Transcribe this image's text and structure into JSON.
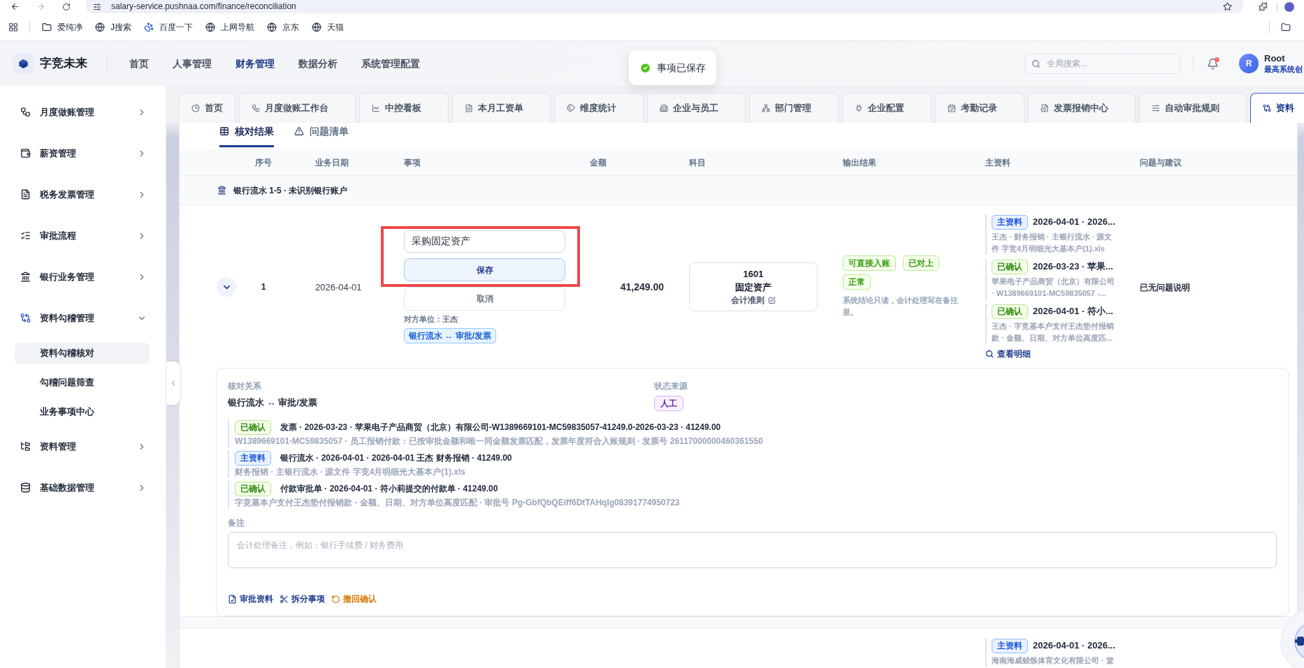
{
  "browser": {
    "url": "salary-service.pushnaa.com/finance/reconciliation",
    "bookmarks": [
      "爱纯净",
      "J搜索",
      "百度一下",
      "上网导航",
      "京东",
      "天猫"
    ]
  },
  "header": {
    "brand": "字竞未来",
    "nav": [
      {
        "label": "首页",
        "selected": false
      },
      {
        "label": "人事管理",
        "selected": false
      },
      {
        "label": "财务管理",
        "selected": true
      },
      {
        "label": "数据分析",
        "selected": false
      },
      {
        "label": "系统管理配置",
        "selected": false
      }
    ],
    "search": {
      "placeholder": "全局搜索..."
    },
    "notifications": {
      "unread": true
    },
    "user": {
      "initial": "R",
      "name": "Root",
      "role": "最高系统创"
    }
  },
  "toast": {
    "kind": "success",
    "text": "事项已保存"
  },
  "sidebar": {
    "items": [
      {
        "label": "月度做账管理",
        "expanded": false
      },
      {
        "label": "薪资管理",
        "expanded": false
      },
      {
        "label": "税务发票管理",
        "expanded": false
      },
      {
        "label": "审批流程",
        "expanded": false
      },
      {
        "label": "银行业务管理",
        "expanded": false
      },
      {
        "label": "资料勾稽管理",
        "expanded": true,
        "children": [
          {
            "label": "资料勾稽核对",
            "selected": true
          },
          {
            "label": "勾稽问题筛查",
            "selected": false
          },
          {
            "label": "业务事项中心",
            "selected": false
          }
        ]
      },
      {
        "label": "资料管理",
        "expanded": false
      },
      {
        "label": "基础数据管理",
        "expanded": false
      }
    ]
  },
  "tabs": [
    {
      "label": "首页",
      "selected": false
    },
    {
      "label": "月度做账工作台",
      "selected": false
    },
    {
      "label": "中控看板",
      "selected": false
    },
    {
      "label": "本月工资单",
      "selected": false
    },
    {
      "label": "维度统计",
      "selected": false
    },
    {
      "label": "企业与员工",
      "selected": false
    },
    {
      "label": "部门管理",
      "selected": false
    },
    {
      "label": "企业配置",
      "selected": false
    },
    {
      "label": "考勤记录",
      "selected": false
    },
    {
      "label": "发票报销中心",
      "selected": false
    },
    {
      "label": "自动审批规则",
      "selected": false
    },
    {
      "label": "资料",
      "selected": true
    }
  ],
  "view_tabs": [
    {
      "label": "核对结果",
      "selected": true
    },
    {
      "label": "问题清单",
      "selected": false
    }
  ],
  "table": {
    "columns": [
      "序号",
      "业务日期",
      "事项",
      "金额",
      "科目",
      "输出结果",
      "主资料",
      "问题与建议"
    ],
    "groups": [
      {
        "title": "银行流水 1-5 · 未识别银行账户",
        "rows": [
          {
            "expanded": true,
            "seq": "1",
            "date": "2026-04-01",
            "editor": {
              "value": "采购固定资产",
              "save": "保存",
              "cancel": "取消"
            },
            "counterparty": "对方单位：王杰",
            "relation_tag": "银行流水 ↔ 审批/发票",
            "amount": "41,249.00",
            "subject": {
              "code": "1601",
              "name": "固定资产",
              "link": "会计准则"
            },
            "output": {
              "tags": [
                "可直接入账",
                "已对上",
                "正常"
              ],
              "note": "系统结论只读，会计处理写在备注里。"
            },
            "main_data": [
              {
                "kind": "primary",
                "badge": "主资料",
                "title": "2026-04-01 · 2026...",
                "detail": "王杰 · 财务报销 · 主银行流水 · 源文件 字竞4月明细光大基本户(1).xls"
              },
              {
                "kind": "confirmed",
                "badge": "已确认",
                "title": "2026-03-23 · 苹果...",
                "detail": "苹果电子产品商贸（北京）有限公司 · W1389669101-MC59835057 -..."
              },
              {
                "kind": "confirmed",
                "badge": "已确认",
                "title": "2026-04-01 · 符小...",
                "detail": "王杰 · 字竞基本户支付王杰垫付报销款 · 金额、日期、对方单位高度匹..."
              }
            ],
            "view_detail": "查看明细",
            "issues": "已无问题说明",
            "detail": {
              "relation_label": "核对关系",
              "relation": "银行流水 ↔ 审批/发票",
              "source_label": "状态来源",
              "source": "人工",
              "evidence": [
                {
                  "kind": "confirmed",
                  "badge": "已确认",
                  "title": "发票 · 2026-03-23 · 苹果电子产品商贸（北京）有限公司-W1389669101-MC59835057-41249.0-2026-03-23 · 41249.00",
                  "detail": "W1389669101-MC59835057 · 员工报销付款：已按审批金额和唯一同金额发票匹配，发票年度符合入账规则 · 发票号 26117000000460361550"
                },
                {
                  "kind": "primary",
                  "badge": "主资料",
                  "title": "银行流水 · 2026-04-01 · 2026-04-01 王杰 财务报销 · 41249.00",
                  "detail": "财务报销 · 主银行流水 · 源文件 字竞4月明细光大基本户(1).xls"
                },
                {
                  "kind": "confirmed",
                  "badge": "已确认",
                  "title": "付款审批单 · 2026-04-01 · 符小莉提交的付款单 · 41249.00",
                  "detail": "字竞基本户支付王杰垫付报销款 · 金额、日期、对方单位高度匹配 · 审批号 Pg-GbfQbQEiff6DtTAHqlg08391774950723"
                }
              ],
              "remark_label": "备注",
              "remark": {
                "placeholder": "会计处理备注，例如：银行手续费 / 财务费用"
              },
              "actions": [
                {
                  "kind": "default",
                  "label": "审批资料"
                },
                {
                  "kind": "default",
                  "label": "拆分事项"
                },
                {
                  "kind": "warning",
                  "label": "撤回确认"
                }
              ]
            }
          },
          {
            "main_data": [
              {
                "kind": "primary",
                "badge": "主资料",
                "title": "2026-04-01 · 2026...",
                "detail": "海南海威鲸炼体育文化有限公司 · 篮"
              }
            ]
          }
        ]
      }
    ]
  }
}
